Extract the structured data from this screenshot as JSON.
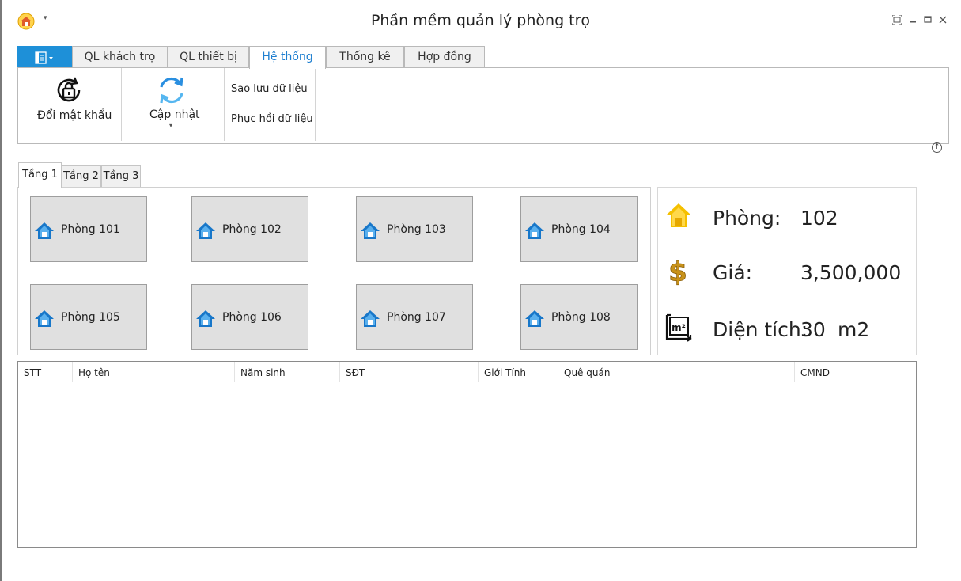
{
  "window": {
    "title": "Phần mềm quản lý phòng trọ",
    "quick_access_dropdown": "▾",
    "controls": [
      "restore-icon",
      "minimize-icon",
      "maximize-icon",
      "close-icon"
    ]
  },
  "ribbon": {
    "tabs": [
      {
        "label": "QL khách trọ"
      },
      {
        "label": "QL thiết bị"
      },
      {
        "label": "Hệ thống",
        "active": true
      },
      {
        "label": "Thống kê"
      },
      {
        "label": "Hợp đồng"
      }
    ],
    "buttons": {
      "change_password": "Đổi mật khẩu",
      "update": "Cập nhật",
      "update_arrow": "▾",
      "backup": "Sao lưu dữ liệu",
      "restore": "Phục hồi dữ liệu"
    }
  },
  "floors": {
    "tabs": [
      {
        "label": "Tầng 1",
        "active": true
      },
      {
        "label": "Tầng 2"
      },
      {
        "label": "Tầng 3"
      }
    ],
    "rooms": [
      "Phòng 101",
      "Phòng 102",
      "Phòng 103",
      "Phòng 104",
      "Phòng 105",
      "Phòng 106",
      "Phòng 107",
      "Phòng 108"
    ]
  },
  "room_info": {
    "room_label": "Phòng:",
    "room_value": "102",
    "price_label": "Giá:",
    "price_value": "3,500,000",
    "area_label": "Diện tích:",
    "area_value": "30",
    "area_unit": "m2"
  },
  "tenant_grid": {
    "columns": [
      "STT",
      "Họ tên",
      "Năm sinh",
      "SĐT",
      "Giới Tính",
      "Quê quán",
      "CMND"
    ],
    "rows": []
  },
  "colors": {
    "accent": "#1e90d8",
    "active_tab_text": "#1e7fd0",
    "room_tile": "#e0e0e0",
    "house_icon_info": "#f5c000",
    "dollar_icon": "#c8921a"
  }
}
